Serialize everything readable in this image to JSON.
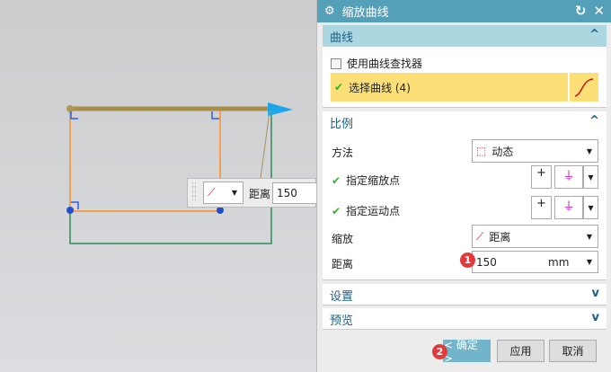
{
  "dialog": {
    "title": "缩放曲线"
  },
  "curve_section": {
    "title": "曲线",
    "use_finder_label": "使用曲线查找器",
    "select_curve_label": "选择曲线 (4)"
  },
  "scale_section": {
    "title": "比例",
    "method_label": "方法",
    "method_value": "动态",
    "scale_point_label": "指定缩放点",
    "motion_point_label": "指定运动点",
    "scale_label": "缩放",
    "scale_value": "距离",
    "distance_label": "距离",
    "distance_value": "150",
    "distance_unit": "mm"
  },
  "settings_section": {
    "title": "设置"
  },
  "preview_section": {
    "title": "预览"
  },
  "buttons": {
    "ok": "< 确定 >",
    "apply": "应用",
    "cancel": "取消"
  },
  "badges": [
    "1",
    "2"
  ],
  "floating": {
    "label": "距离",
    "value": "150"
  }
}
